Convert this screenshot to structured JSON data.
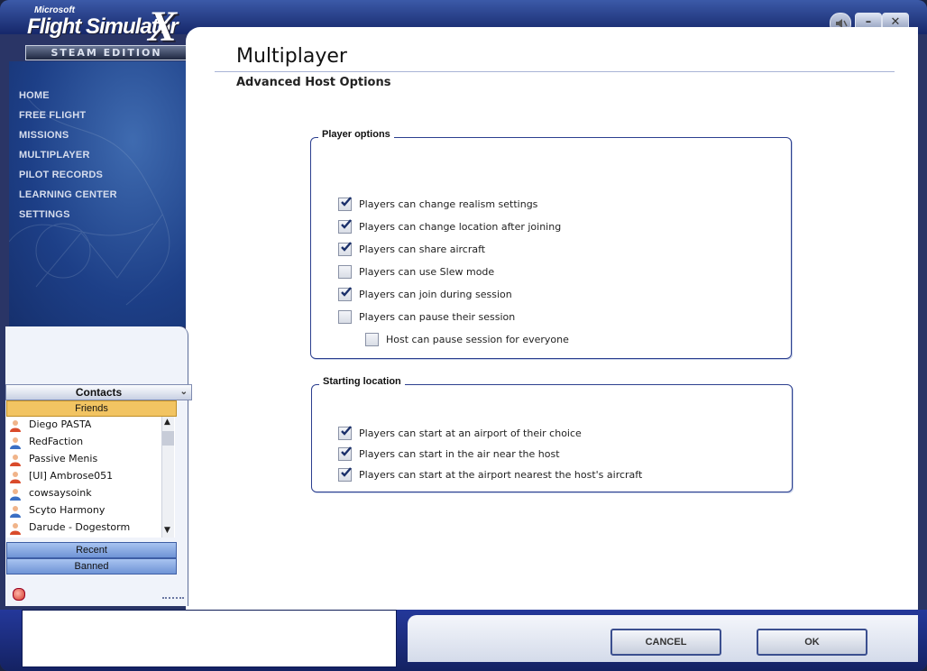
{
  "app": {
    "logo_ms": "Microsoft",
    "logo_title": "Flight Simulator",
    "logo_x": "X",
    "logo_edition": "STEAM EDITION"
  },
  "window_controls": {
    "minimize": "–",
    "close": "✕"
  },
  "nav": {
    "items": [
      {
        "label": "HOME"
      },
      {
        "label": "FREE FLIGHT"
      },
      {
        "label": "MISSIONS"
      },
      {
        "label": "MULTIPLAYER"
      },
      {
        "label": "PILOT RECORDS"
      },
      {
        "label": "LEARNING CENTER"
      },
      {
        "label": "SETTINGS"
      }
    ]
  },
  "page": {
    "title": "Multiplayer",
    "subtitle": "Advanced Host Options"
  },
  "player_options": {
    "label": "Player options",
    "options": [
      {
        "label": "Players can change realism settings",
        "checked": true
      },
      {
        "label": "Players can change location after joining",
        "checked": true
      },
      {
        "label": "Players can share aircraft",
        "checked": true
      },
      {
        "label": "Players can use Slew mode",
        "checked": false
      },
      {
        "label": "Players can join during session",
        "checked": true
      },
      {
        "label": "Players can pause their session",
        "checked": false
      },
      {
        "label": "Host can pause session for everyone",
        "checked": false
      }
    ]
  },
  "starting_location": {
    "label": "Starting location",
    "options": [
      {
        "label": "Players can start at an airport of their choice",
        "checked": true
      },
      {
        "label": "Players can start in the air near the host",
        "checked": true
      },
      {
        "label": "Players can start at the airport nearest the host's aircraft",
        "checked": true
      }
    ]
  },
  "contacts": {
    "title": "Contacts",
    "friends_label": "Friends",
    "friends": [
      {
        "name": "Diego PASTA",
        "status": "away"
      },
      {
        "name": "RedFaction",
        "status": "online"
      },
      {
        "name": "Passive Menis",
        "status": "away"
      },
      {
        "name": "[UI] Ambrose051",
        "status": "away"
      },
      {
        "name": "cowsaysoink",
        "status": "online"
      },
      {
        "name": "Scyto Harmony",
        "status": "online"
      },
      {
        "name": "Darude - Dogestorm",
        "status": "away"
      }
    ],
    "recent_label": "Recent",
    "banned_label": "Banned"
  },
  "footer": {
    "cancel_label": "CANCEL",
    "ok_label": "OK"
  },
  "colors": {
    "frame": "#2a3566",
    "nav_bg": "#1d3f87",
    "group_border": "#2c3f8f",
    "friends_header": "#f2c462",
    "side_button": "#6f93d6"
  }
}
